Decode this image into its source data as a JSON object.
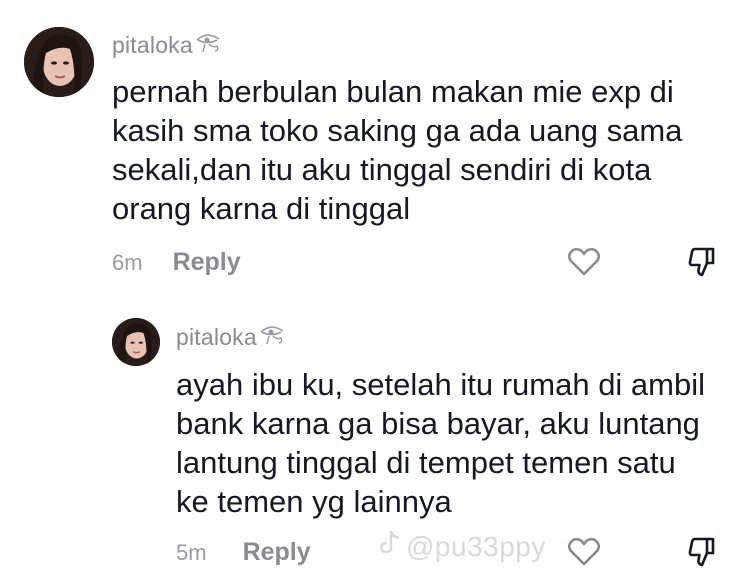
{
  "comments": [
    {
      "username": "pitaloka",
      "text": "pernah berbulan bulan makan mie exp di\nkasih sma toko saking ga ada uang sama\nsekali,dan itu aku tinggal sendiri di kota\norang karna di tinggal",
      "time": "6m",
      "reply_label": "Reply",
      "badge_icon": "eye-of-horus-icon"
    },
    {
      "username": "pitaloka",
      "text": "ayah ibu ku, setelah itu rumah di ambil\nbank karna ga bisa bayar, aku luntang\nlantung tinggal di tempet temen satu\nke temen yg lainnya",
      "time": "5m",
      "reply_label": "Reply",
      "badge_icon": "eye-of-horus-icon"
    }
  ],
  "watermark": {
    "text": "@pu33ppy",
    "icon": "tiktok-logo-icon"
  },
  "icons": {
    "like": "heart-outline-icon",
    "dislike": "thumbs-down-outline-icon"
  },
  "colors": {
    "text": "#161823",
    "muted": "#8a8b91",
    "watermark": "#d9d9dd"
  }
}
